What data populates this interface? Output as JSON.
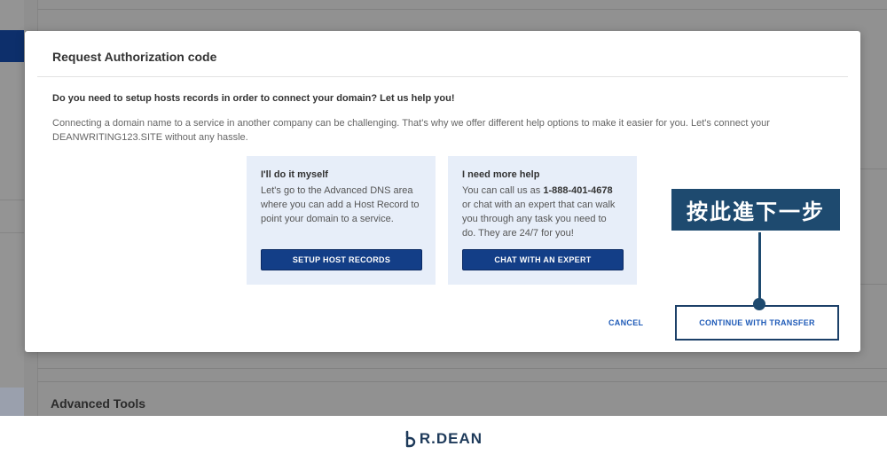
{
  "background": {
    "section_title": "Advanced Tools"
  },
  "modal": {
    "title": "Request Authorization code",
    "question": "Do you need to setup hosts records in order to connect your domain? Let us help you!",
    "description": "Connecting a domain name to a service in another company can be challenging. That's why we offer different help options to make it easier for you. Let's connect your DEANWRITING123.SITE without any hassle.",
    "cards": [
      {
        "title": "I'll do it myself",
        "text": "Let's go to the Advanced DNS area where you can add a Host Record to point your domain to a service.",
        "button": "SETUP HOST RECORDS"
      },
      {
        "title": "I need more help",
        "text_before": "You can call us as ",
        "phone": "1-888-401-4678",
        "text_after": " or chat with an expert that can walk you through any task you need to do. They are 24/7 for you!",
        "button": "CHAT WITH AN EXPERT"
      }
    ],
    "cancel_label": "CANCEL",
    "continue_label": "CONTINUE WITH TRANSFER"
  },
  "annotation": {
    "text": "按此進下一步"
  },
  "brand": {
    "text": "R.DEAN"
  },
  "colors": {
    "primary_button": "#133e87",
    "link_blue": "#1f5bb8",
    "callout": "#1e4a6f",
    "card_bg": "#e7eef9"
  }
}
